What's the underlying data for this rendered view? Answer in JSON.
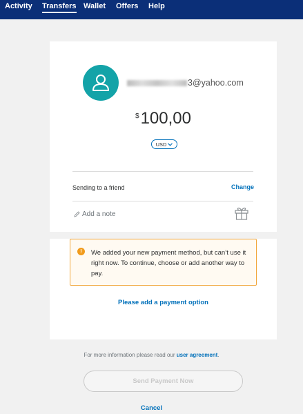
{
  "nav": {
    "items": [
      {
        "label": "Activity"
      },
      {
        "label": "Transfers"
      },
      {
        "label": "Wallet"
      },
      {
        "label": "Offers"
      },
      {
        "label": "Help"
      }
    ],
    "active": "Transfers"
  },
  "recipient": {
    "email_suffix": "3@yahoo.com",
    "avatar_icon": "user-icon"
  },
  "amount": {
    "symbol": "$",
    "value": "100,00",
    "currency": "USD"
  },
  "sending": {
    "label": "Sending to a friend",
    "change": "Change"
  },
  "note": {
    "placeholder": "Add a note"
  },
  "alert": {
    "icon": "!",
    "message": "We added your new payment method, but can’t use it right now. To continue, choose or add another way to pay."
  },
  "add_payment": "Please add a payment option",
  "footer": {
    "info_prefix": "For more information please read our",
    "link": "user agreement",
    "info_suffix": "."
  },
  "send_button": "Send Payment Now",
  "cancel": "Cancel",
  "colors": {
    "nav_bg": "#0b2f78",
    "link": "#0070ba",
    "avatar": "#13a3a8",
    "alert_border": "#f1a63a"
  }
}
